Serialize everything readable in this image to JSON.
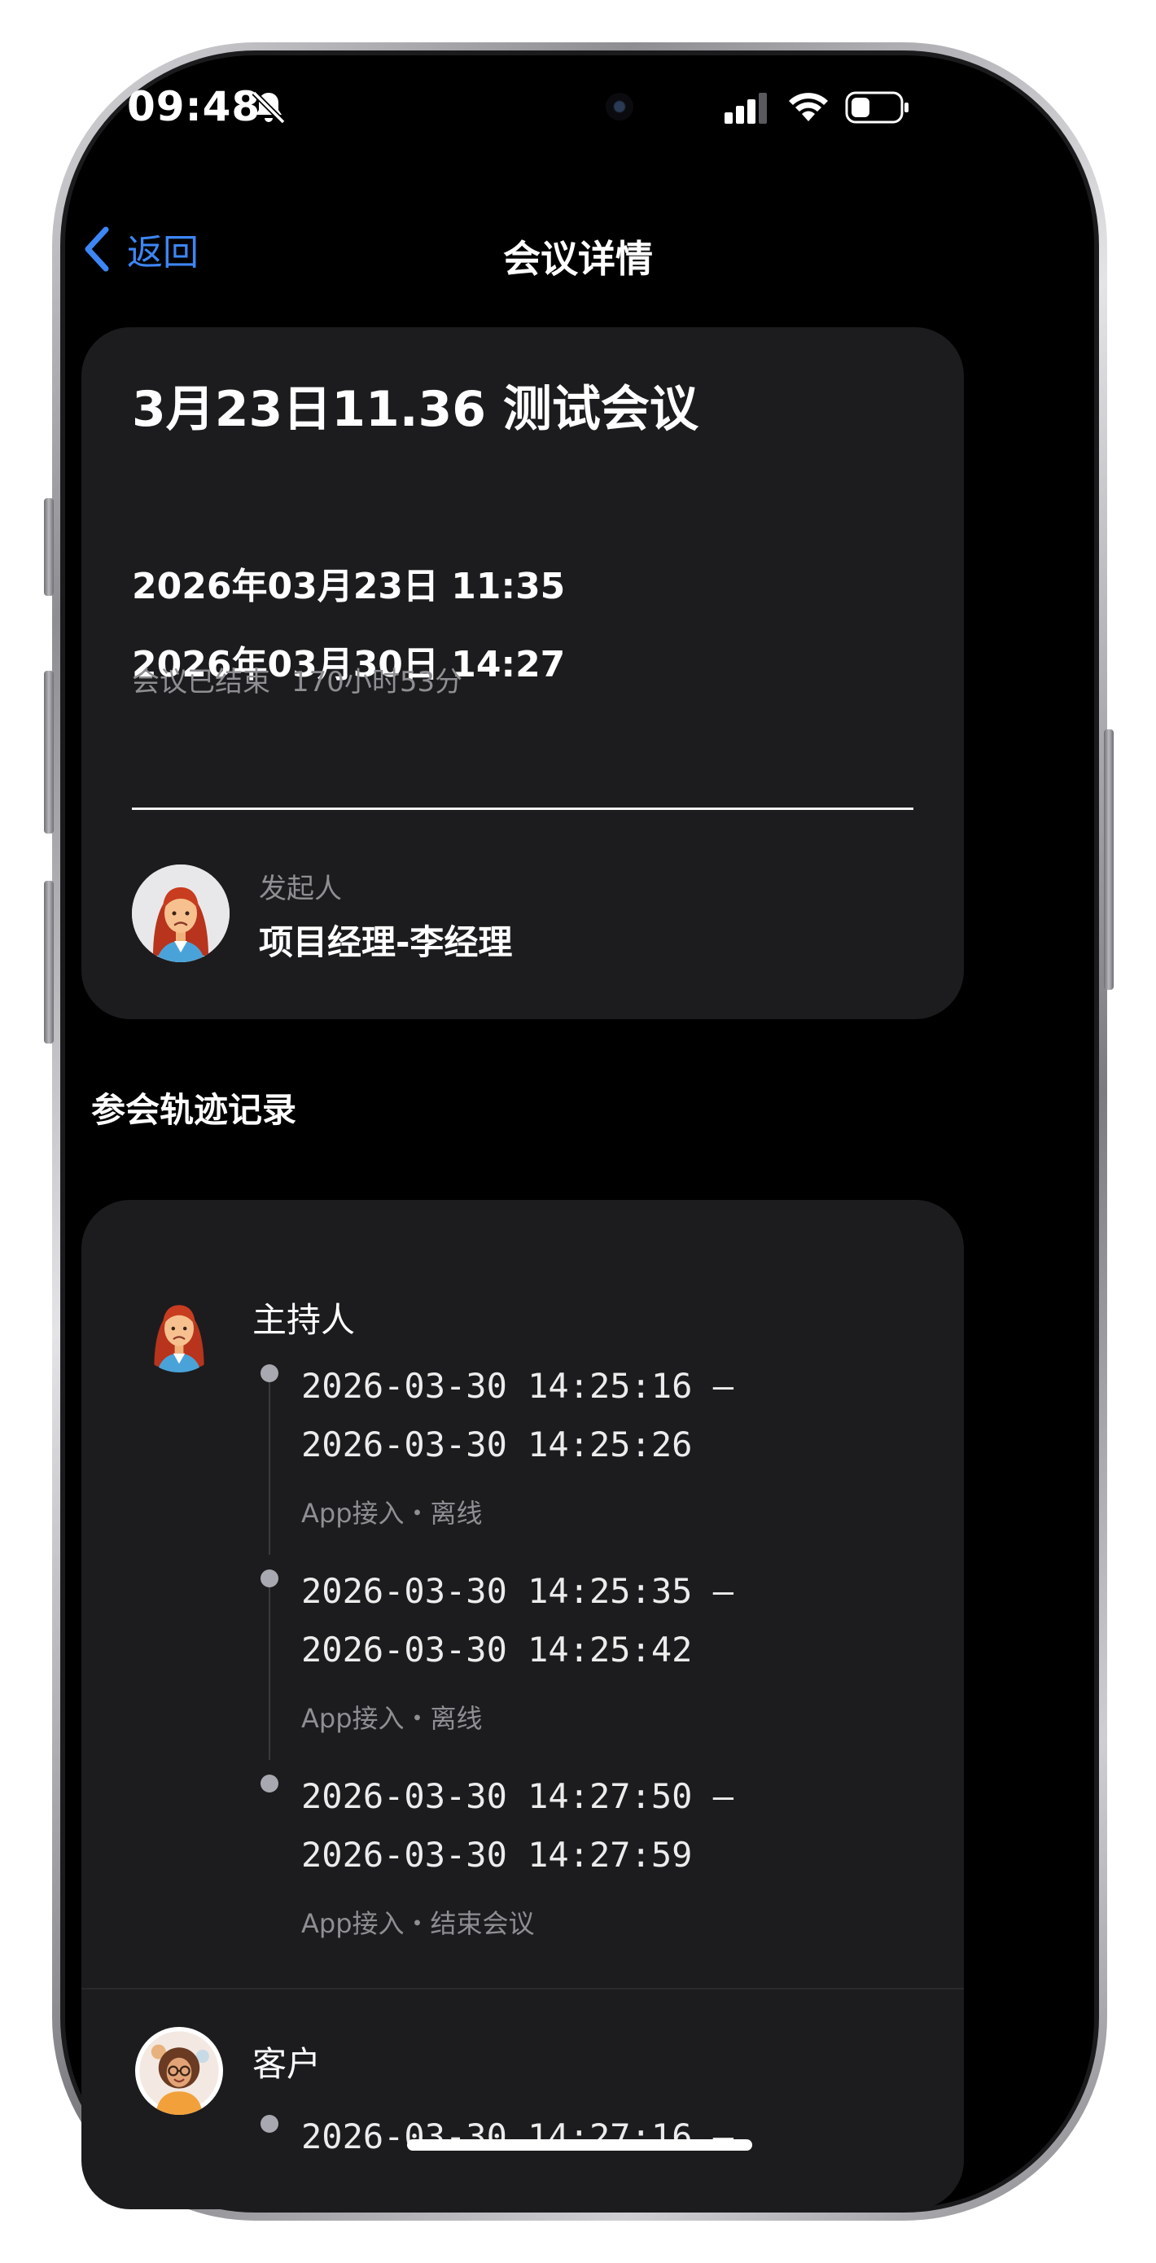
{
  "status_bar": {
    "time": "09:48"
  },
  "nav": {
    "back_label": "返回",
    "title": "会议详情"
  },
  "meeting": {
    "title": "3月23日11.36 测试会议",
    "start_time": "2026年03月23日 11:35",
    "end_time": "2026年03月30日 14:27",
    "status": "会议已结束",
    "duration": "170小时53分",
    "initiator_caption": "发起人",
    "initiator_name": "项目经理-李经理"
  },
  "records": {
    "section_title": "参会轨迹记录",
    "participants": [
      {
        "role": "主持人",
        "entries": [
          {
            "start": "2026-03-30 14:25:16 –",
            "end": "2026-03-30 14:25:26",
            "meta": "App接入・离线"
          },
          {
            "start": "2026-03-30 14:25:35 –",
            "end": "2026-03-30 14:25:42",
            "meta": "App接入・离线"
          },
          {
            "start": "2026-03-30 14:27:50 –",
            "end": "2026-03-30 14:27:59",
            "meta": "App接入・结束会议"
          }
        ]
      },
      {
        "role": "客户",
        "entries": [
          {
            "start": "2026-03-30 14:27:16 –"
          }
        ]
      }
    ]
  },
  "colors": {
    "accent": "#3d86f5",
    "card_bg": "#1c1c1e",
    "muted_text": "#8e8e93"
  }
}
